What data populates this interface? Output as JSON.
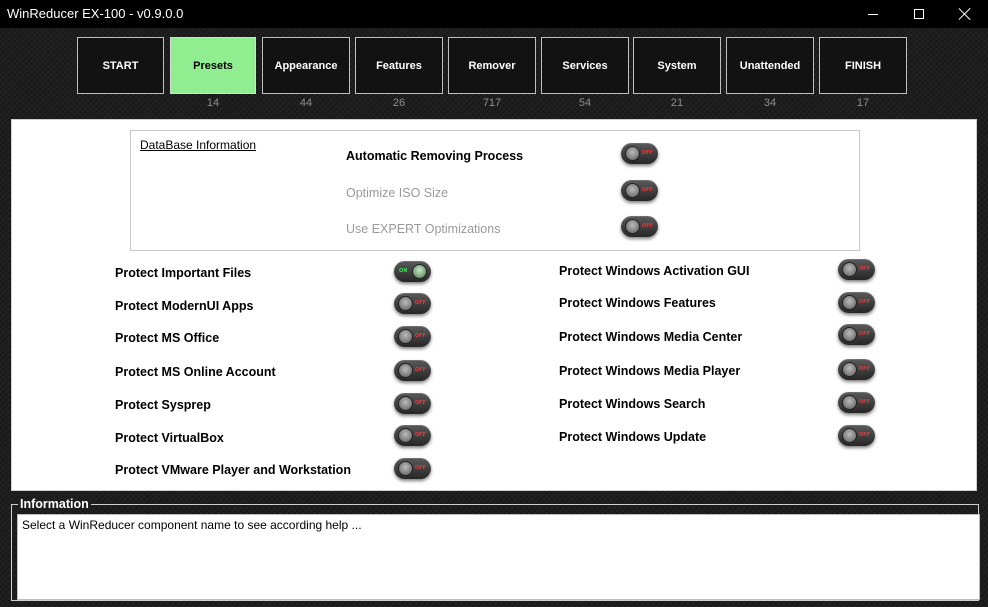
{
  "window": {
    "title": "WinReducer EX-100 - v0.9.0.0"
  },
  "nav": {
    "items": [
      {
        "label": "START",
        "count": ""
      },
      {
        "label": "Presets",
        "count": "14"
      },
      {
        "label": "Appearance",
        "count": "44"
      },
      {
        "label": "Features",
        "count": "26"
      },
      {
        "label": "Remover",
        "count": "717"
      },
      {
        "label": "Services",
        "count": "54"
      },
      {
        "label": "System",
        "count": "21"
      },
      {
        "label": "Unattended",
        "count": "34"
      },
      {
        "label": "FINISH",
        "count": "17"
      }
    ],
    "active_label": "Presets",
    "active_color": "#90ee90"
  },
  "database": {
    "link_label": "DataBase Information",
    "options": [
      {
        "label": "Automatic Removing Process",
        "state": "OFF",
        "enabled": true
      },
      {
        "label": "Optimize ISO Size",
        "state": "OFF",
        "enabled": false
      },
      {
        "label": "Use EXPERT Optimizations",
        "state": "OFF",
        "enabled": false
      }
    ]
  },
  "protect_left": [
    {
      "label": "Protect Important Files",
      "state": "ON"
    },
    {
      "label": "Protect ModernUI Apps",
      "state": "OFF"
    },
    {
      "label": "Protect MS Office",
      "state": "OFF"
    },
    {
      "label": "Protect MS Online Account",
      "state": "OFF"
    },
    {
      "label": "Protect Sysprep",
      "state": "OFF"
    },
    {
      "label": "Protect VirtualBox",
      "state": "OFF"
    },
    {
      "label": "Protect VMware Player and Workstation",
      "state": "OFF"
    }
  ],
  "protect_right": [
    {
      "label": "Protect Windows Activation GUI",
      "state": "OFF"
    },
    {
      "label": "Protect Windows Features",
      "state": "OFF"
    },
    {
      "label": "Protect Windows Media Center",
      "state": "OFF"
    },
    {
      "label": "Protect Windows Media Player",
      "state": "OFF"
    },
    {
      "label": "Protect Windows Search",
      "state": "OFF"
    },
    {
      "label": "Protect Windows Update",
      "state": "OFF"
    }
  ],
  "toggle_colors": {
    "on": "#3ddc5a",
    "off": "#e23a3a"
  },
  "information": {
    "title": "Information",
    "text": "Select a WinReducer component name to see according help ..."
  }
}
